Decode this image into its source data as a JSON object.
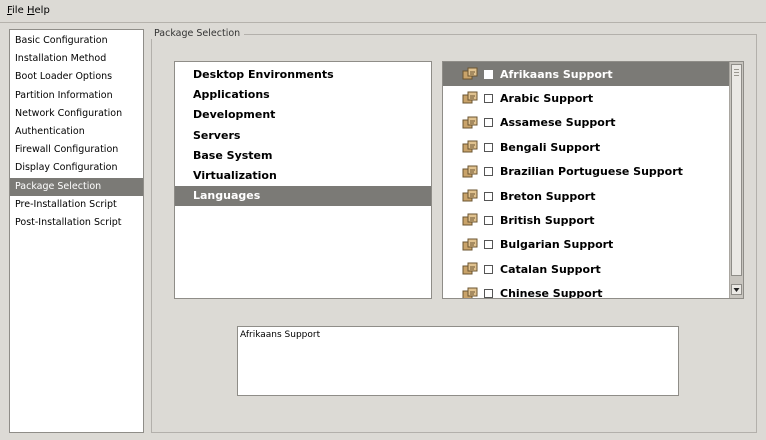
{
  "menubar": {
    "file": {
      "mnemonic": "F",
      "rest": "ile"
    },
    "help": {
      "mnemonic": "H",
      "rest": "elp"
    }
  },
  "sidebar": {
    "items": [
      {
        "label": "Basic Configuration"
      },
      {
        "label": "Installation Method"
      },
      {
        "label": "Boot Loader Options"
      },
      {
        "label": "Partition Information"
      },
      {
        "label": "Network Configuration"
      },
      {
        "label": "Authentication"
      },
      {
        "label": "Firewall Configuration"
      },
      {
        "label": "Display Configuration"
      },
      {
        "label": "Package Selection",
        "selected": true
      },
      {
        "label": "Pre-Installation Script"
      },
      {
        "label": "Post-Installation Script"
      }
    ]
  },
  "main": {
    "frame_title": "Package Selection",
    "groups": [
      {
        "label": "Desktop Environments"
      },
      {
        "label": "Applications"
      },
      {
        "label": "Development"
      },
      {
        "label": "Servers"
      },
      {
        "label": "Base System"
      },
      {
        "label": "Virtualization"
      },
      {
        "label": "Languages",
        "selected": true
      }
    ],
    "packages": [
      {
        "label": "Afrikaans Support",
        "selected": true,
        "checked": false
      },
      {
        "label": "Arabic Support",
        "checked": false
      },
      {
        "label": "Assamese Support",
        "checked": false
      },
      {
        "label": "Bengali Support",
        "checked": false
      },
      {
        "label": "Brazilian Portuguese Support",
        "checked": false
      },
      {
        "label": "Breton Support",
        "checked": false
      },
      {
        "label": "British Support",
        "checked": false
      },
      {
        "label": "Bulgarian Support",
        "checked": false
      },
      {
        "label": "Catalan Support",
        "checked": false
      },
      {
        "label": "Chinese Support",
        "checked": false
      }
    ],
    "description": "Afrikaans Support"
  },
  "icons": {
    "package": "package-group-icon",
    "scroll_up": "scroll-up-arrow-icon",
    "scroll_down": "scroll-down-arrow-icon"
  },
  "colors": {
    "selection": "#7b7a76",
    "window_bg": "#dcdad5"
  }
}
